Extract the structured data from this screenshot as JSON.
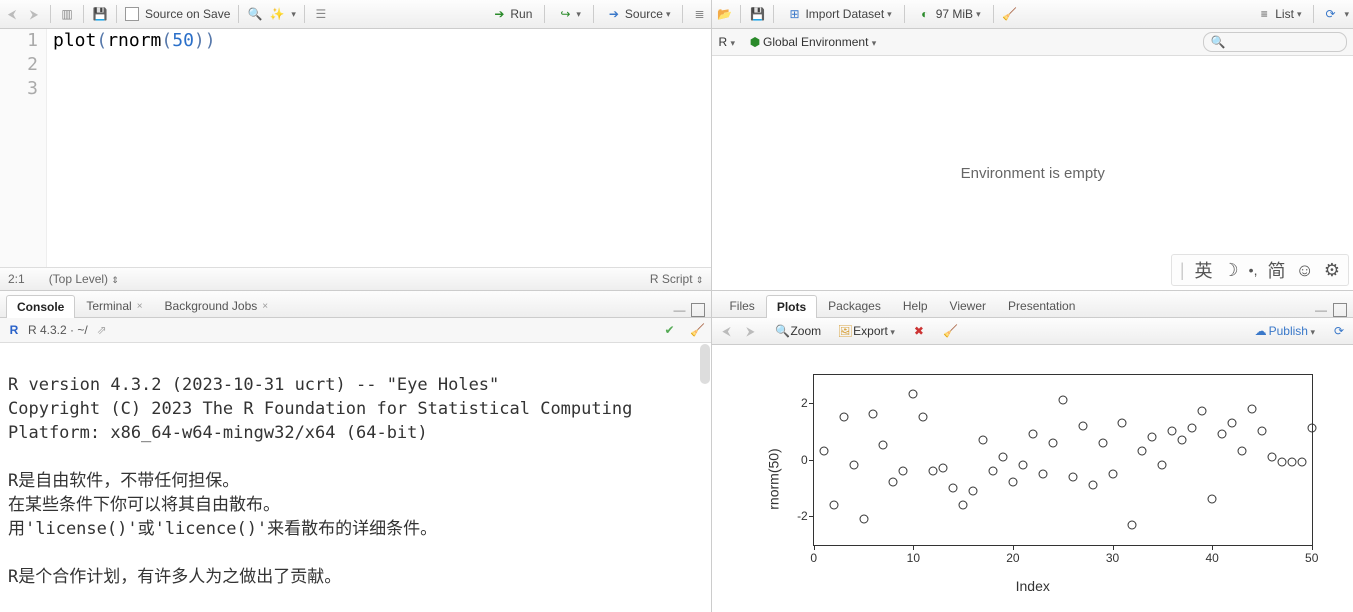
{
  "editor": {
    "toolbar": {
      "source_on_save": "Source on Save",
      "run": "Run",
      "source": "Source"
    },
    "gutter": [
      "1",
      "2",
      "3"
    ],
    "code_tokens": {
      "fn1": "plot",
      "p1": "(",
      "fn2": "rnorm",
      "p2": "(",
      "num": "50",
      "p3": ")",
      "p4": ")"
    },
    "status": {
      "pos": "2:1",
      "scope": "(Top Level)",
      "lang": "R Script"
    }
  },
  "console": {
    "tabs": {
      "console": "Console",
      "terminal": "Terminal",
      "bg": "Background Jobs"
    },
    "sub": {
      "version": "R 4.3.2 · ~/"
    },
    "text": "\nR version 4.3.2 (2023-10-31 ucrt) -- \"Eye Holes\"\nCopyright (C) 2023 The R Foundation for Statistical Computing\nPlatform: x86_64-w64-mingw32/x64 (64-bit)\n\nR是自由软件，不带任何担保。\n在某些条件下你可以将其自由散布。\n用'license()'或'licence()'来看散布的详细条件。\n\nR是个合作计划，有许多人为之做出了贡献。"
  },
  "env": {
    "toolbar": {
      "import": "Import Dataset",
      "mem": "97 MiB",
      "list": "List"
    },
    "sub": {
      "lang": "R",
      "scope": "Global Environment"
    },
    "empty_text": "Environment is empty",
    "ime": {
      "a": "英",
      "b": "简"
    }
  },
  "plots": {
    "tabs": {
      "files": "Files",
      "plots": "Plots",
      "packages": "Packages",
      "help": "Help",
      "viewer": "Viewer",
      "presentation": "Presentation"
    },
    "sub": {
      "zoom": "Zoom",
      "export": "Export",
      "publish": "Publish"
    }
  },
  "chart_data": {
    "type": "scatter",
    "title": "",
    "xlabel": "Index",
    "ylabel": "rnorm(50)",
    "xlim": [
      0,
      50
    ],
    "ylim": [
      -3,
      3
    ],
    "xticks": [
      0,
      10,
      20,
      30,
      40,
      50
    ],
    "yticks": [
      -2,
      0,
      2
    ],
    "x": [
      1,
      2,
      3,
      4,
      5,
      6,
      7,
      8,
      9,
      10,
      11,
      12,
      13,
      14,
      15,
      16,
      17,
      18,
      19,
      20,
      21,
      22,
      23,
      24,
      25,
      26,
      27,
      28,
      29,
      30,
      31,
      32,
      33,
      34,
      35,
      36,
      37,
      38,
      39,
      40,
      41,
      42,
      43,
      44,
      45,
      46,
      47,
      48,
      49,
      50
    ],
    "y": [
      0.3,
      -1.6,
      1.5,
      -0.2,
      -2.1,
      1.6,
      0.5,
      -0.8,
      -0.4,
      2.3,
      1.5,
      -0.4,
      -0.3,
      -1.0,
      -1.6,
      -1.1,
      0.7,
      -0.4,
      0.1,
      -0.8,
      -0.2,
      0.9,
      -0.5,
      0.6,
      2.1,
      -0.6,
      1.2,
      -0.9,
      0.6,
      -0.5,
      1.3,
      -2.3,
      0.3,
      0.8,
      -0.2,
      1.0,
      0.7,
      1.1,
      1.7,
      -1.4,
      0.9,
      1.3,
      0.3,
      1.8,
      1.0,
      0.1,
      -0.1,
      -0.1,
      -0.1,
      1.1
    ]
  }
}
